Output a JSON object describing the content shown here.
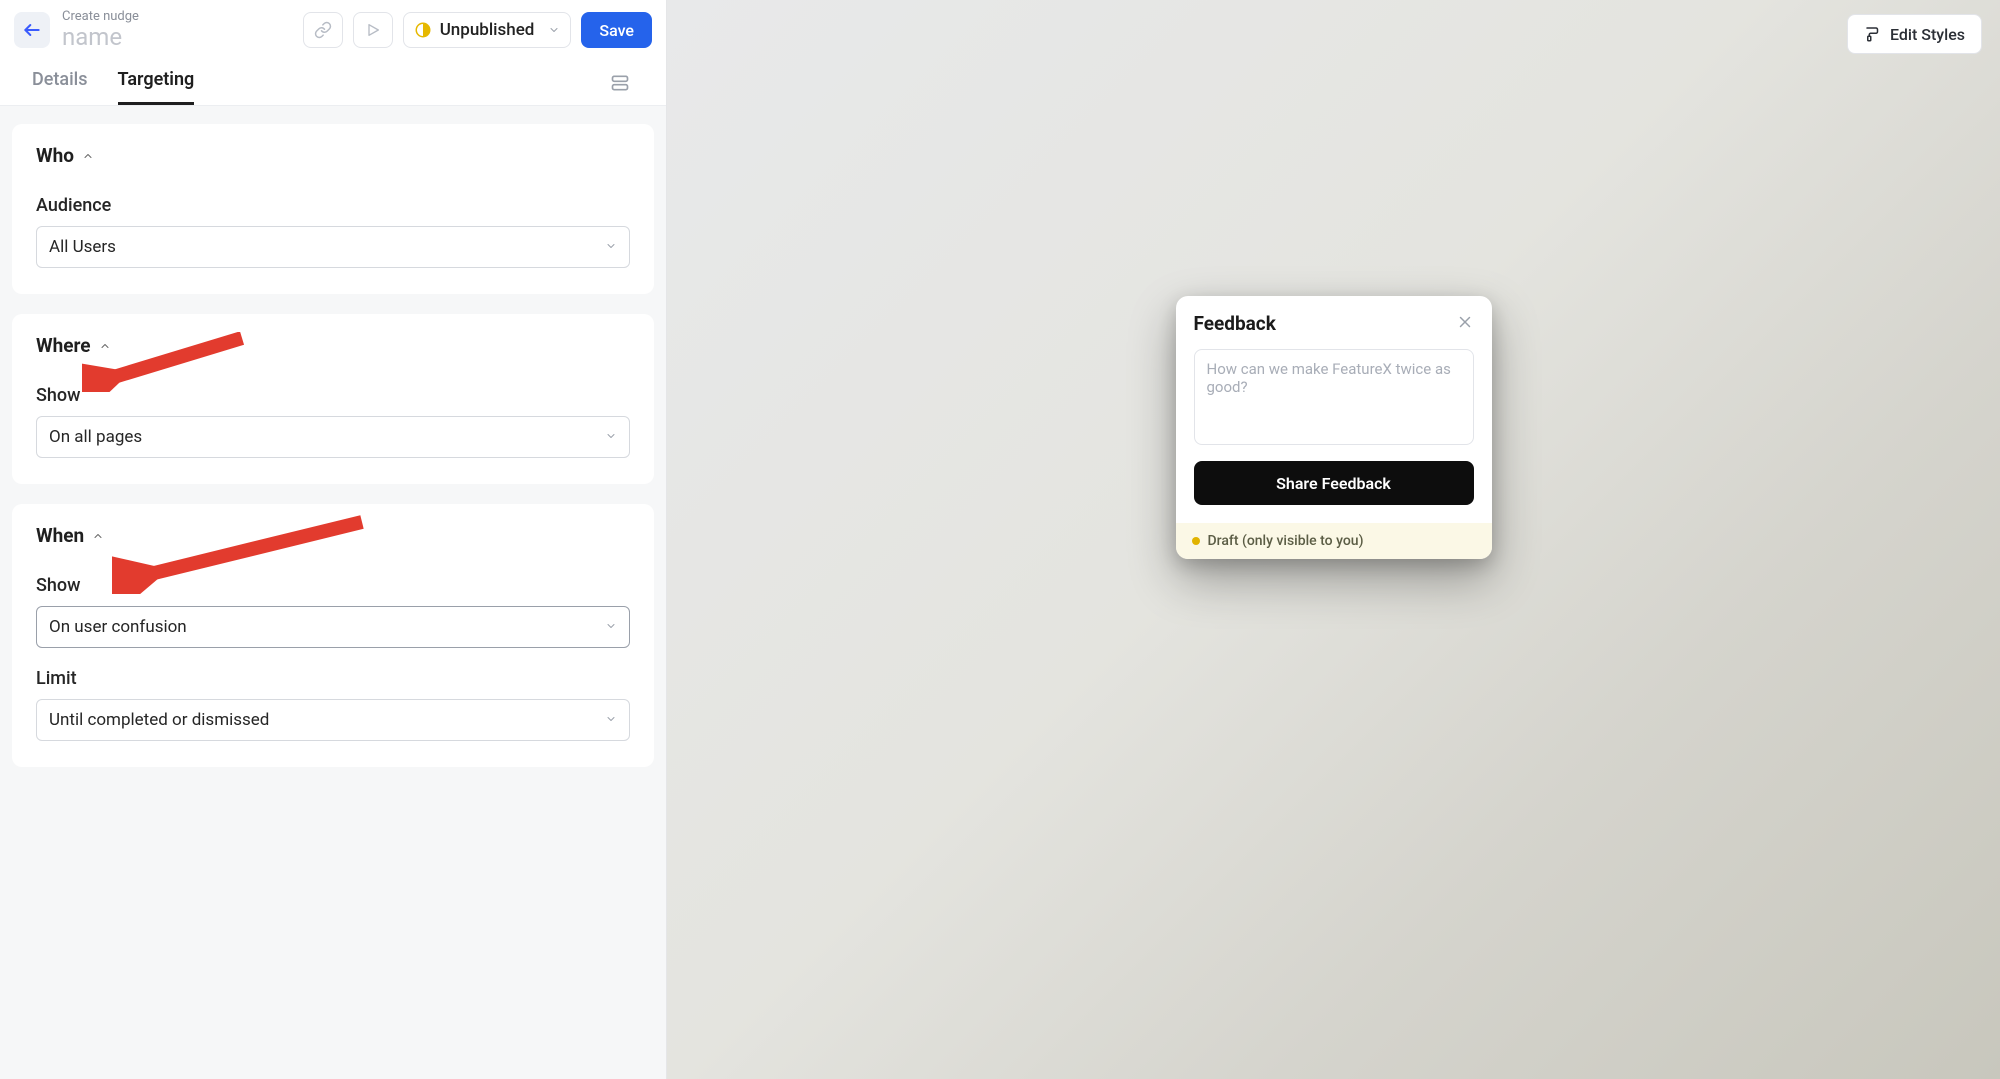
{
  "header": {
    "kicker": "Create nudge",
    "name_placeholder": "name",
    "status_label": "Unpublished",
    "save_label": "Save"
  },
  "tabs": {
    "details": "Details",
    "targeting": "Targeting"
  },
  "who": {
    "title": "Who",
    "audience_label": "Audience",
    "audience_value": "All Users"
  },
  "where": {
    "title": "Where",
    "show_label": "Show",
    "show_value": "On all pages"
  },
  "when": {
    "title": "When",
    "show_label": "Show",
    "show_value": "On user confusion",
    "limit_label": "Limit",
    "limit_value": "Until completed or dismissed"
  },
  "right": {
    "edit_styles": "Edit Styles"
  },
  "feedback": {
    "title": "Feedback",
    "placeholder": "How can we make FeatureX twice as good?",
    "share_label": "Share Feedback",
    "draft_label": "Draft (only visible to you)"
  }
}
